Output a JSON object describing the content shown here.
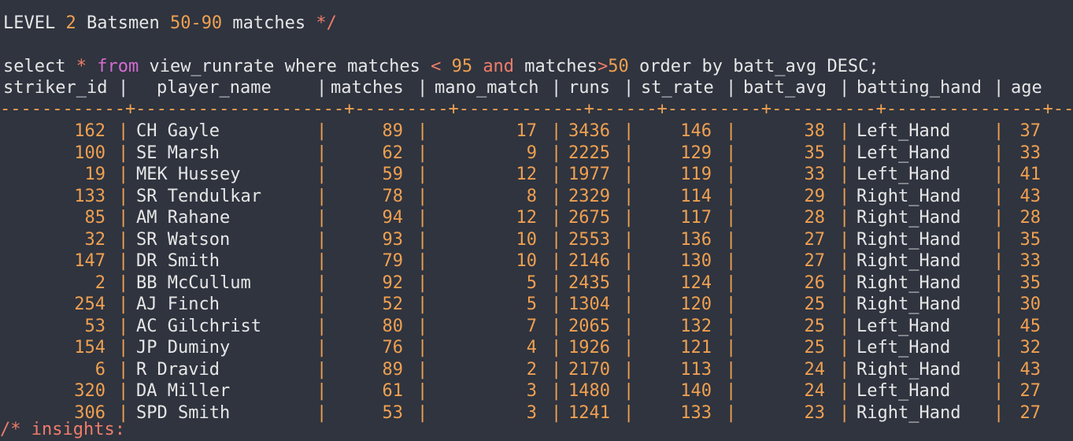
{
  "comment_line": {
    "prefix": "LEVEL ",
    "level": "2",
    "mid": " Batsmen ",
    "range": "50-90",
    "suffix": " matches ",
    "close": "*/"
  },
  "query": {
    "select": "select ",
    "star": "*",
    "from": " from ",
    "view": "view_runrate where matches ",
    "lt": "<",
    "v95": " 95 ",
    "and": "and",
    "matches2": " matches",
    "gt": ">",
    "v50": "50",
    "tail": " order by batt_avg DESC;"
  },
  "columns": [
    "striker_id",
    "player_name",
    "matches",
    "mano_match",
    "runs",
    "st_rate",
    "batt_avg",
    "batting_hand",
    "age"
  ],
  "rows": [
    [
      "162",
      "CH Gayle",
      "89",
      "17",
      "3436",
      "146",
      "38",
      "Left_Hand",
      "37"
    ],
    [
      "100",
      "SE Marsh",
      "62",
      "9",
      "2225",
      "129",
      "35",
      "Left_Hand",
      "33"
    ],
    [
      "19",
      "MEK Hussey",
      "59",
      "12",
      "1977",
      "119",
      "33",
      "Left_Hand",
      "41"
    ],
    [
      "133",
      "SR Tendulkar",
      "78",
      "8",
      "2329",
      "114",
      "29",
      "Right_Hand",
      "43"
    ],
    [
      "85",
      "AM Rahane",
      "94",
      "12",
      "2675",
      "117",
      "28",
      "Right_Hand",
      "28"
    ],
    [
      "32",
      "SR Watson",
      "93",
      "10",
      "2553",
      "136",
      "27",
      "Right_Hand",
      "35"
    ],
    [
      "147",
      "DR Smith",
      "79",
      "10",
      "2146",
      "130",
      "27",
      "Right_Hand",
      "33"
    ],
    [
      "2",
      "BB McCullum",
      "92",
      "5",
      "2435",
      "124",
      "26",
      "Right_Hand",
      "35"
    ],
    [
      "254",
      "AJ Finch",
      "52",
      "5",
      "1304",
      "120",
      "25",
      "Right_Hand",
      "30"
    ],
    [
      "53",
      "AC Gilchrist",
      "80",
      "7",
      "2065",
      "132",
      "25",
      "Left_Hand",
      "45"
    ],
    [
      "154",
      "JP Duminy",
      "76",
      "4",
      "1926",
      "121",
      "25",
      "Left_Hand",
      "32"
    ],
    [
      "6",
      "R Dravid",
      "89",
      "2",
      "2170",
      "113",
      "24",
      "Right_Hand",
      "43"
    ],
    [
      "320",
      "DA Miller",
      "61",
      "3",
      "1480",
      "140",
      "24",
      "Left_Hand",
      "27"
    ],
    [
      "306",
      "SPD Smith",
      "53",
      "3",
      "1241",
      "133",
      "23",
      "Right_Hand",
      "27"
    ]
  ],
  "bottom_partial": "/* insights:",
  "colors": {
    "background": "#2f343f",
    "number": "#f0a050",
    "keyword": "#d56bd2",
    "text": "#e6e6e6"
  }
}
